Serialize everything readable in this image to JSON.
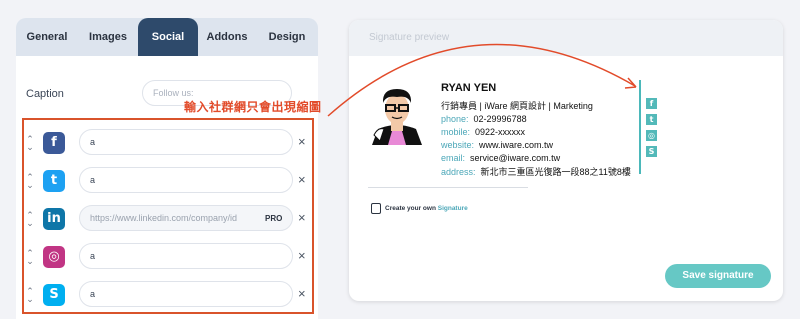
{
  "tabs": [
    "General",
    "Images",
    "Social",
    "Addons",
    "Design"
  ],
  "active_tab": "Social",
  "caption": {
    "label": "Caption",
    "placeholder": "Follow us:"
  },
  "annotation": "輸入社群網只會出現縮圖",
  "social_rows": [
    {
      "icon": "facebook-icon",
      "glyph": "f",
      "color": "#3b5998",
      "value": "a"
    },
    {
      "icon": "twitter-icon",
      "glyph": "t",
      "color": "#1da1f2",
      "value": "a"
    },
    {
      "icon": "linkedin-icon",
      "glyph": "in",
      "color": "#0e76a8",
      "value": "https://www.linkedin.com/company/id",
      "badge": "PRO"
    },
    {
      "icon": "instagram-icon",
      "glyph": "◎",
      "color": "#c13584",
      "value": "a"
    },
    {
      "icon": "skype-icon",
      "glyph": "S",
      "color": "#00aff0",
      "value": "a"
    }
  ],
  "remove_label": "×",
  "preview": {
    "title": "Signature preview",
    "name": "RYAN YEN",
    "job": "行銷專員 | iWare 網頁設計 | Marketing",
    "lines": [
      {
        "key": "phone:",
        "value": "02-29996788"
      },
      {
        "key": "mobile:",
        "value": "0922-xxxxxx"
      },
      {
        "key": "website:",
        "value": "www.iware.com.tw"
      },
      {
        "key": "email:",
        "value": "service@iware.com.tw"
      },
      {
        "key": "address:",
        "value": "新北市三重區光復路一段88之11號8樓"
      }
    ],
    "create_prefix": "Create your own ",
    "create_brand": "Signature",
    "save_label": "Save signature"
  },
  "colors": {
    "accent": "#4ba7b8",
    "active_tab": "#2e4a6b",
    "annotation": "#e24b2a"
  }
}
